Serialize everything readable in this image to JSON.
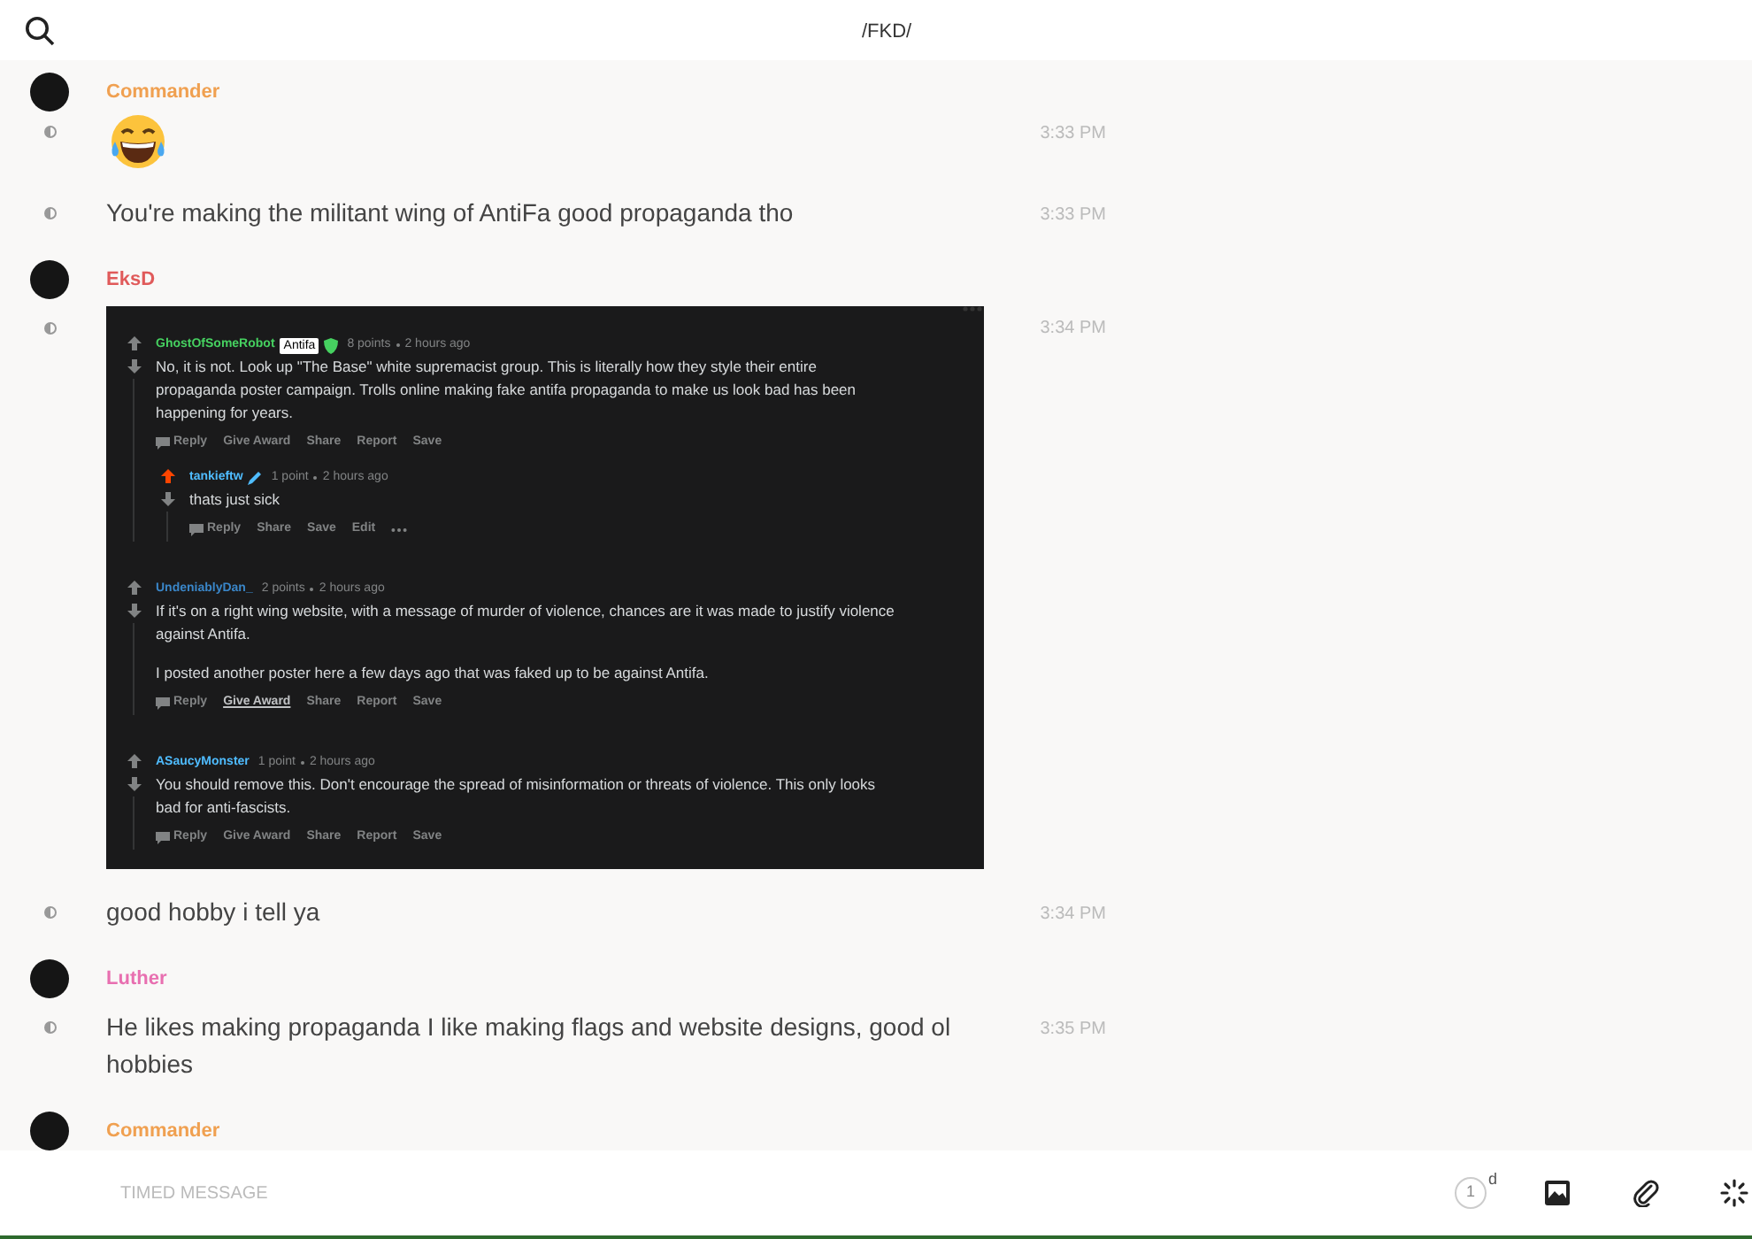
{
  "topbar": {
    "title": "/FKD/"
  },
  "groups": [
    {
      "author": "Commander",
      "color": "#f0a050",
      "messages": [
        {
          "kind": "emoji",
          "time": "3:33 PM"
        },
        {
          "kind": "text",
          "text": "You're making the militant wing of AntiFa good propaganda tho",
          "time": "3:33 PM"
        }
      ]
    },
    {
      "author": "EksD",
      "color": "#e05a5a",
      "messages": [
        {
          "kind": "screenshot",
          "time": "3:34 PM",
          "comments": [
            {
              "user": "GhostOfSomeRobot",
              "color": "#46d160",
              "flair": "Antifa",
              "kind": "shield",
              "points": "8 points",
              "time": "2 hours ago",
              "upvoted": false,
              "paragraphs": [
                "No, it is not. Look up \"The Base\" white supremacist group. This is literally how they style their entire propaganda poster campaign. Trolls online making fake antifa propaganda to make us look bad has been happening for years."
              ],
              "actions": [
                {
                  "label": "Reply",
                  "hovered": false
                },
                {
                  "label": "Give Award",
                  "hovered": false
                },
                {
                  "label": "Share",
                  "hovered": false
                },
                {
                  "label": "Report",
                  "hovered": false
                },
                {
                  "label": "Save",
                  "hovered": false
                }
              ],
              "menu": false,
              "children": [
                {
                  "user": "tankieftw",
                  "color": "#4fbcff",
                  "kind": "pen",
                  "points": "1 point",
                  "time": "2 hours ago",
                  "upvoted": true,
                  "paragraphs": [
                    "thats just sick"
                  ],
                  "actions": [
                    {
                      "label": "Reply",
                      "hovered": false
                    },
                    {
                      "label": "Share",
                      "hovered": false
                    },
                    {
                      "label": "Save",
                      "hovered": false
                    },
                    {
                      "label": "Edit",
                      "hovered": false
                    }
                  ],
                  "menu": true
                }
              ]
            },
            {
              "user": "UndeniablyDan_",
              "color": "#3a86c8",
              "kind": "plain",
              "points": "2 points",
              "time": "2 hours ago",
              "upvoted": false,
              "paragraphs": [
                "If it's on a right wing website, with a message of murder of violence, chances are it was made to justify violence against Antifa.",
                "I posted another poster here a few days ago that was faked up to be against Antifa."
              ],
              "actions": [
                {
                  "label": "Reply",
                  "hovered": false
                },
                {
                  "label": "Give Award",
                  "hovered": true
                },
                {
                  "label": "Share",
                  "hovered": false
                },
                {
                  "label": "Report",
                  "hovered": false
                },
                {
                  "label": "Save",
                  "hovered": false
                }
              ],
              "menu": false
            },
            {
              "user": "ASaucyMonster",
              "color": "#4fbcff",
              "kind": "plain",
              "points": "1 point",
              "time": "2 hours ago",
              "upvoted": false,
              "paragraphs": [
                "You should remove this. Don't encourage the spread of misinformation or threats of violence. This only looks bad for anti-fascists."
              ],
              "actions": [
                {
                  "label": "Reply",
                  "hovered": false
                },
                {
                  "label": "Give Award",
                  "hovered": false
                },
                {
                  "label": "Share",
                  "hovered": false
                },
                {
                  "label": "Report",
                  "hovered": false
                },
                {
                  "label": "Save",
                  "hovered": false
                }
              ],
              "menu": false
            }
          ]
        },
        {
          "kind": "text",
          "text": "good hobby i tell ya",
          "time": "3:34 PM"
        }
      ]
    },
    {
      "author": "Luther",
      "color": "#e86fb0",
      "messages": [
        {
          "kind": "text",
          "text": "He likes making propaganda I like making flags and website designs, good ol hobbies",
          "time": "3:35 PM"
        }
      ]
    },
    {
      "author": "Commander",
      "color": "#f0a050"
    }
  ],
  "composer": {
    "placeholder": "TIMED MESSAGE",
    "timer": "1",
    "timer_unit": "d"
  }
}
